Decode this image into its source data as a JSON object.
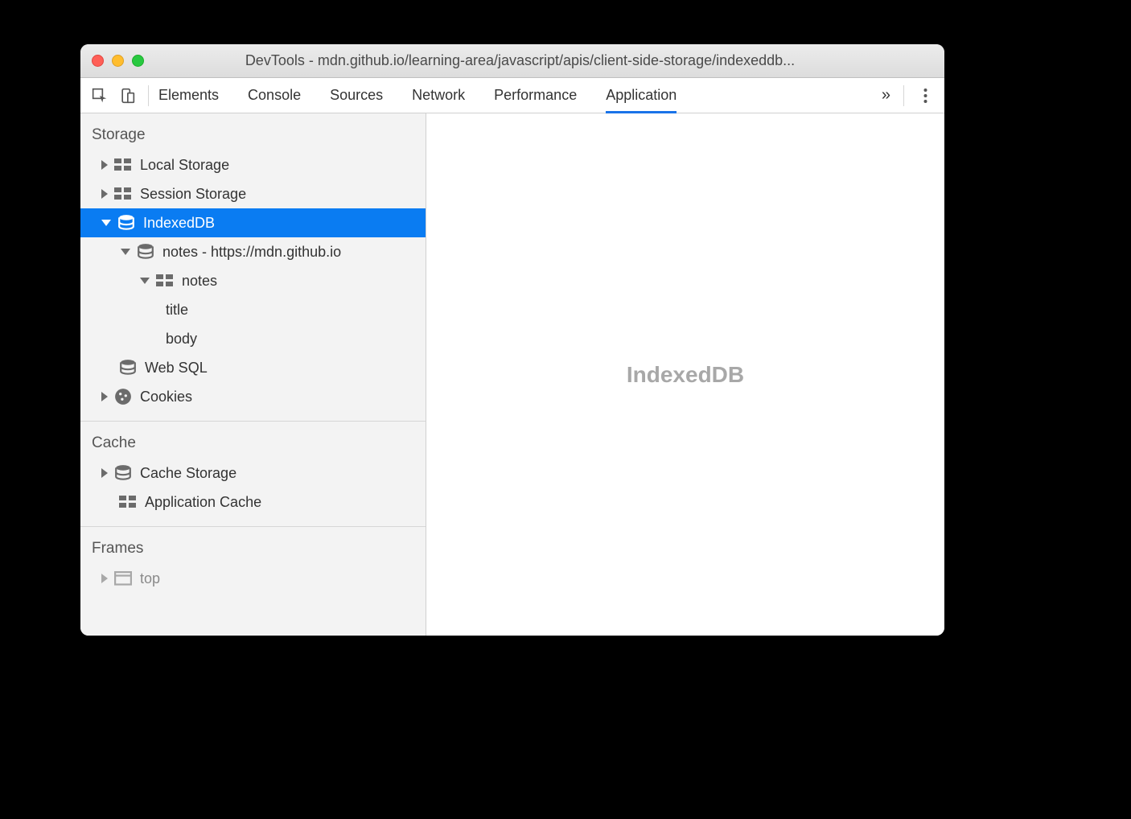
{
  "window": {
    "title": "DevTools - mdn.github.io/learning-area/javascript/apis/client-side-storage/indexeddb..."
  },
  "tabs": {
    "elements": "Elements",
    "console": "Console",
    "sources": "Sources",
    "network": "Network",
    "performance": "Performance",
    "application": "Application",
    "overflow": "»"
  },
  "sidebar": {
    "sections": {
      "storage": "Storage",
      "cache": "Cache",
      "frames": "Frames"
    },
    "storage": {
      "local": "Local Storage",
      "session": "Session Storage",
      "indexeddb": "IndexedDB",
      "indexeddb_children": {
        "db": "notes - https://mdn.github.io",
        "store": "notes",
        "index_title": "title",
        "index_body": "body"
      },
      "websql": "Web SQL",
      "cookies": "Cookies"
    },
    "cache": {
      "cache_storage": "Cache Storage",
      "app_cache": "Application Cache"
    },
    "frames": {
      "top": "top"
    }
  },
  "main": {
    "placeholder": "IndexedDB"
  }
}
